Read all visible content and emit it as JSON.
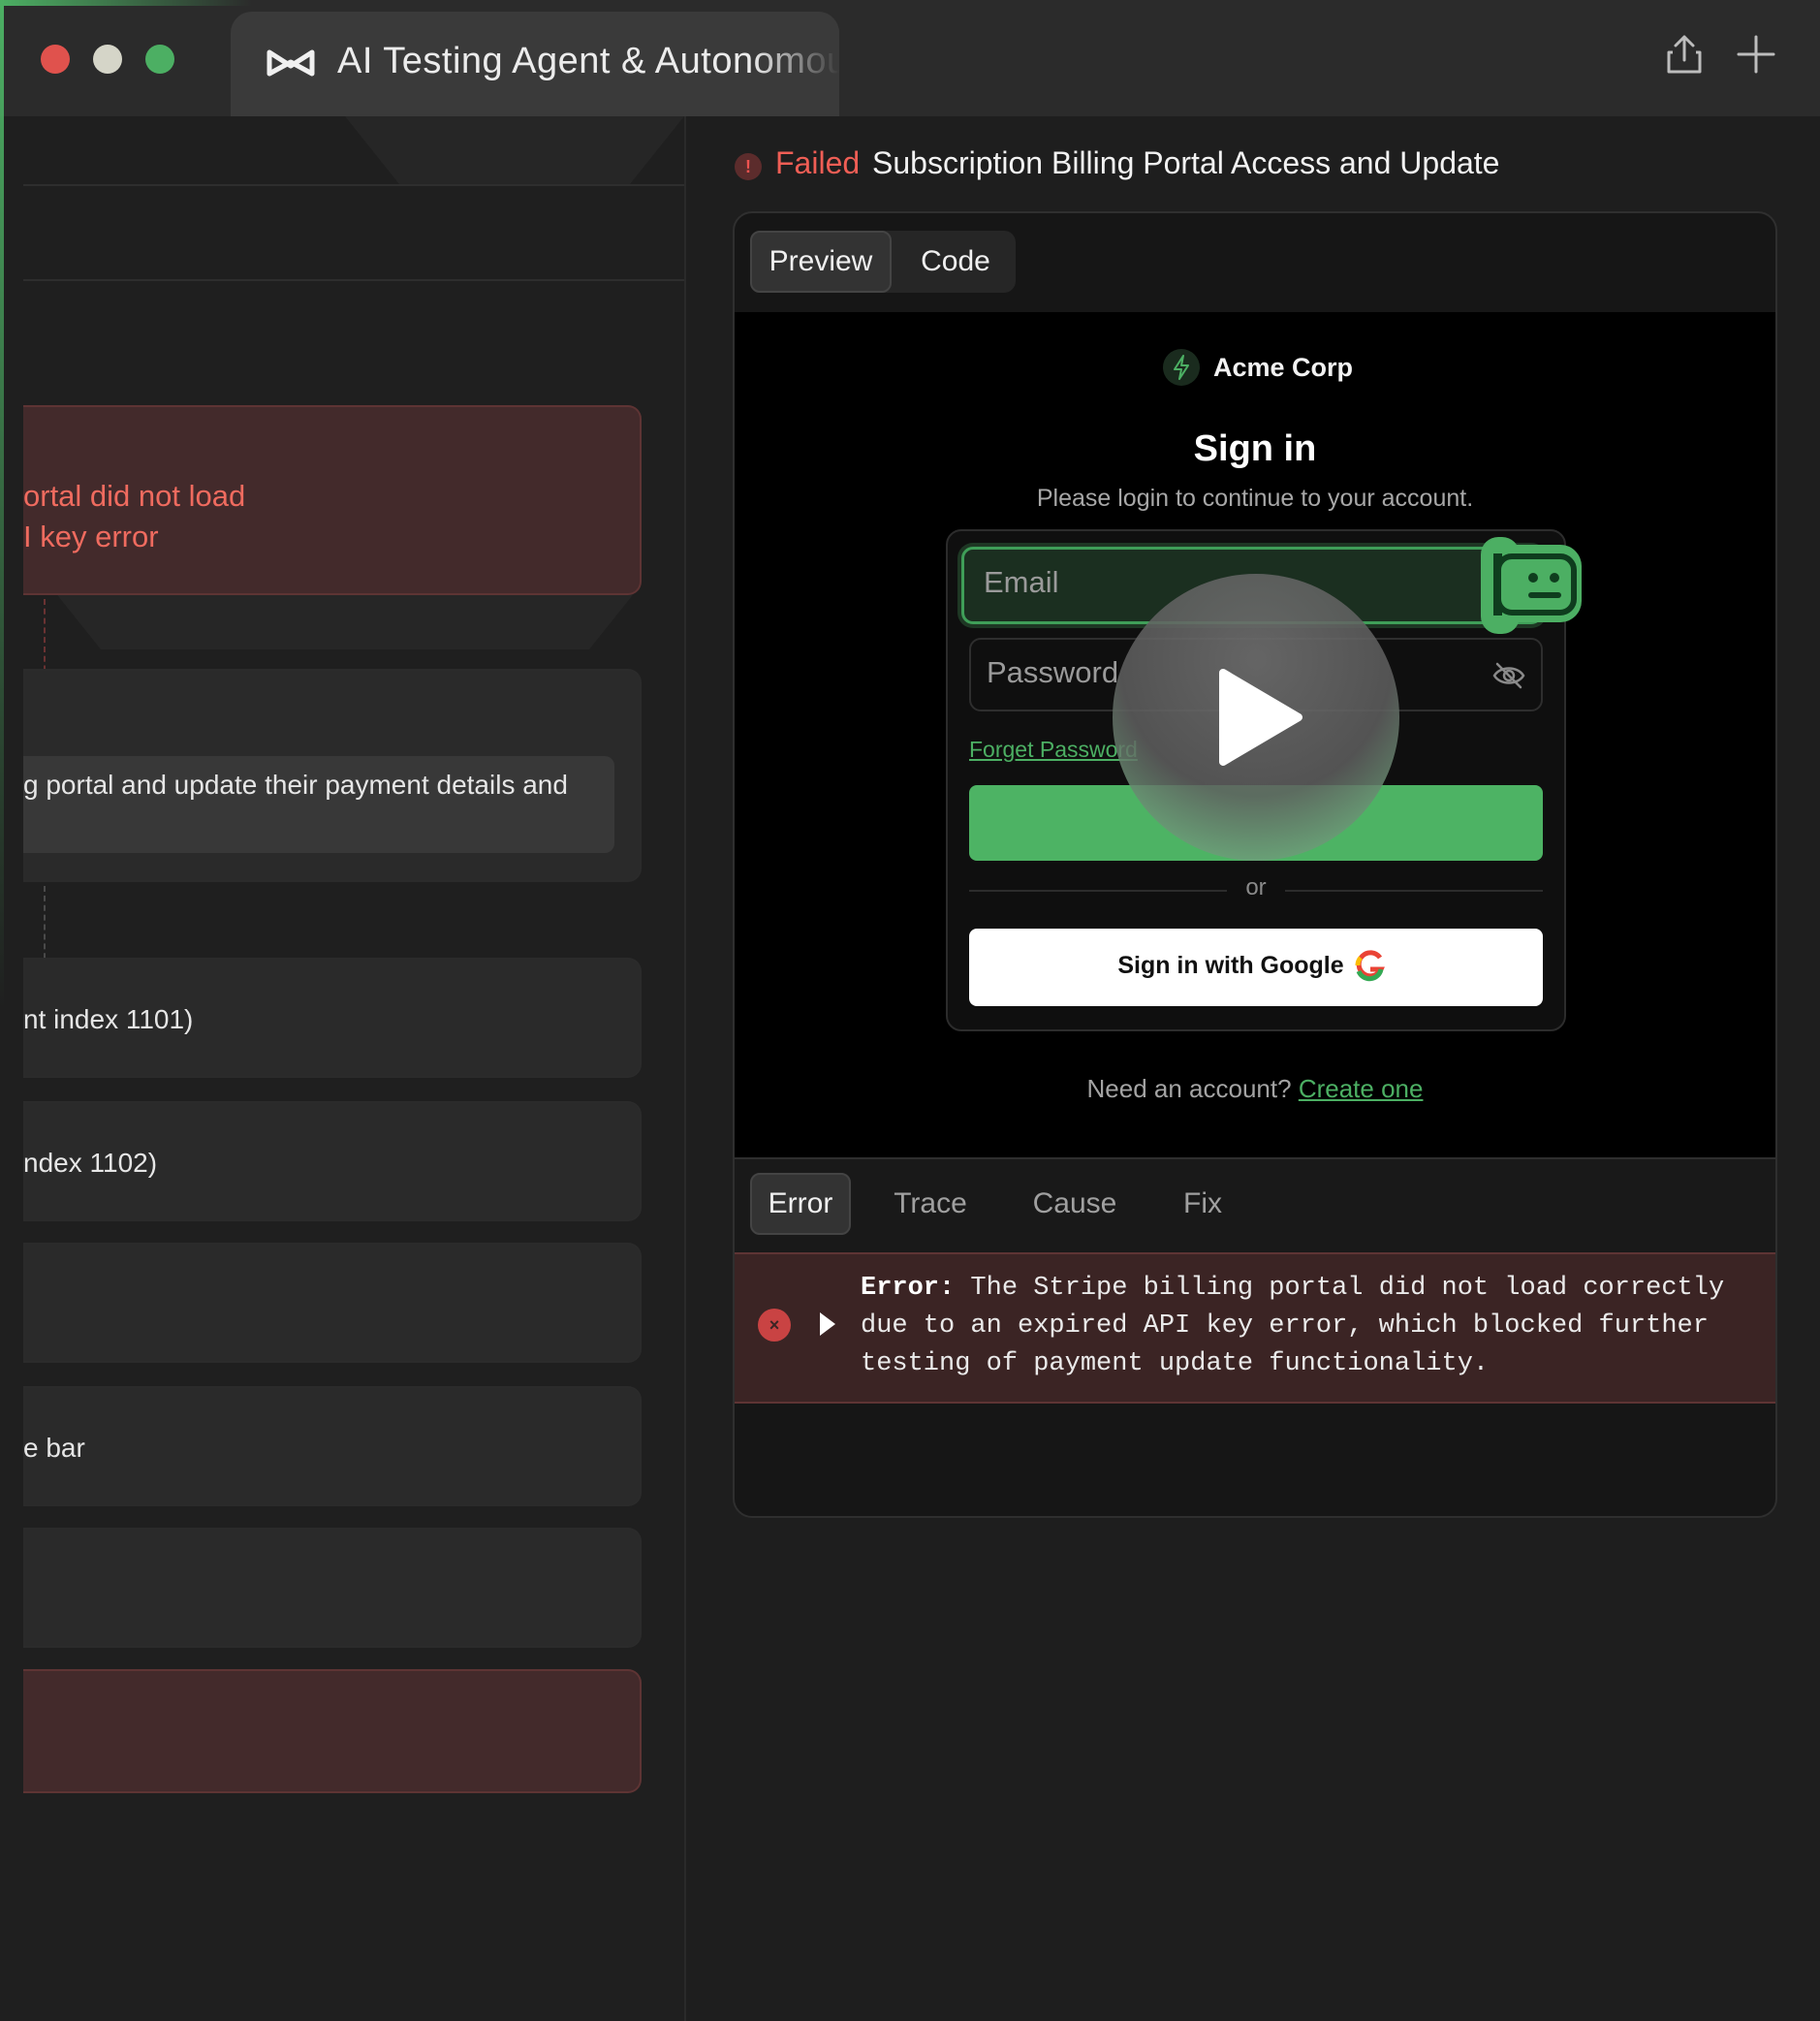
{
  "window": {
    "tab_title": "AI Testing Agent & Autonomous",
    "traffic_colors": [
      "#e0524d",
      "#d5d5c8",
      "#4caf63"
    ]
  },
  "left_panel": {
    "error_card_line1": "ortal did not load",
    "error_card_line2": "I key error",
    "description_text": "g portal and update their payment details and",
    "steps": [
      {
        "text": "nt index 1101)"
      },
      {
        "text": "ndex 1102)"
      },
      {
        "text": ""
      },
      {
        "text": "e bar"
      },
      {
        "text": ""
      }
    ]
  },
  "status": {
    "icon_glyph": "!",
    "label": "Failed",
    "title": "Subscription Billing Portal Access and Update",
    "color": "#ef5e55"
  },
  "view_tabs": [
    {
      "label": "Preview",
      "active": true
    },
    {
      "label": "Code",
      "active": false
    }
  ],
  "preview": {
    "brand_name": "Acme Corp",
    "title": "Sign in",
    "subtitle": "Please login to continue to your account.",
    "email_placeholder": "Email",
    "password_placeholder": "Password",
    "forgot_link": "Forget Password",
    "or_text": "or",
    "google_button": "Sign in with Google",
    "need_account": "Need an account?",
    "create_link": "Create one",
    "accent_color": "#4caf63"
  },
  "result_tabs": [
    {
      "label": "Error",
      "active": true
    },
    {
      "label": "Trace",
      "active": false
    },
    {
      "label": "Cause",
      "active": false
    },
    {
      "label": "Fix",
      "active": false
    }
  ],
  "error": {
    "icon_glyph": "×",
    "label": "Error:",
    "message": "The Stripe billing portal did not load correctly due to an expired API key error, which blocked further testing of payment update functionality."
  }
}
